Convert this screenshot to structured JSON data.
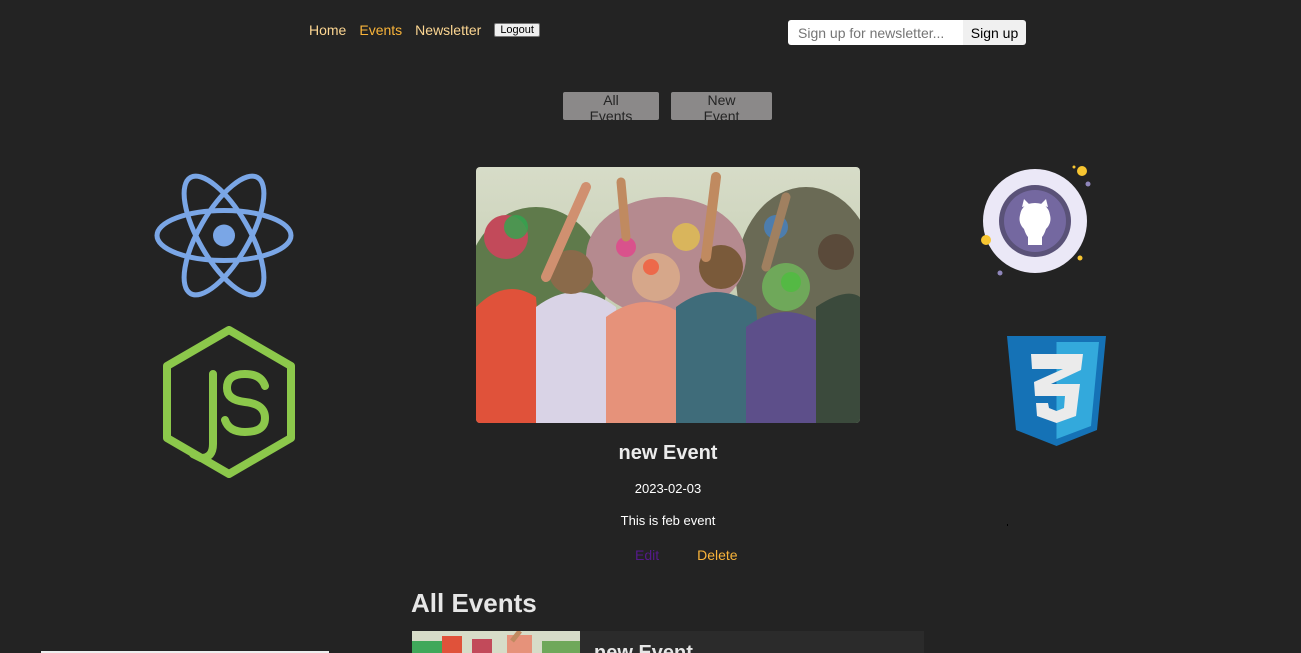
{
  "nav": {
    "home": "Home",
    "events": "Events",
    "newsletter": "Newsletter",
    "logout": "Logout"
  },
  "newsletter_form": {
    "placeholder": "Sign up for newsletter...",
    "value": "",
    "button": "Sign up"
  },
  "events_nav": {
    "all_events": "All Events",
    "new_event": "New Event"
  },
  "featured_event": {
    "title": "new Event",
    "date": "2023-02-03",
    "description": "This is feb event",
    "edit": "Edit",
    "delete": "Delete"
  },
  "all_events": {
    "heading": "All Events",
    "items": [
      {
        "title": "new Event"
      }
    ]
  },
  "logos": {
    "left_top": "react-logo",
    "left_bottom": "nodejs-logo",
    "right_top": "github-logo",
    "right_bottom": "css3-logo"
  },
  "colors": {
    "background": "#232323",
    "nav_link": "#fcd692",
    "nav_active": "#f9b43a",
    "button_gray": "#8b8989",
    "edit_link": "#551a8b",
    "delete_link": "#f9b43a"
  }
}
